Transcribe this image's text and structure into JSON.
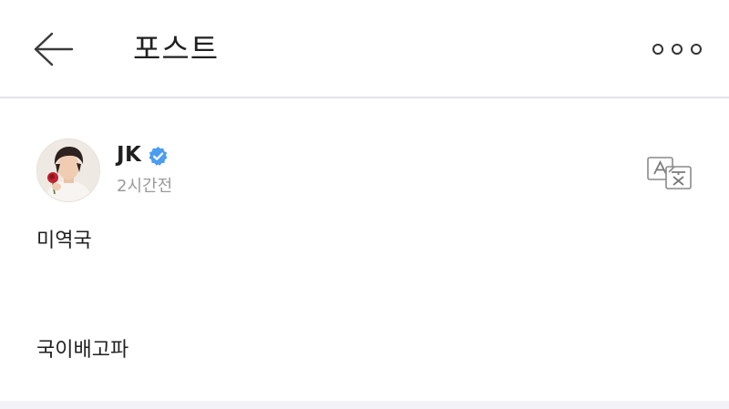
{
  "header": {
    "title": "포스트",
    "back_icon": "arrow-left-icon",
    "more_icon": "more-horizontal-icon"
  },
  "post": {
    "author": {
      "name": "JK",
      "verified": true,
      "verified_color": "#4a9df0"
    },
    "timestamp": "2시간전",
    "translate_icon": "translate-icon",
    "lines": [
      "미역국",
      "국이배고파"
    ]
  }
}
